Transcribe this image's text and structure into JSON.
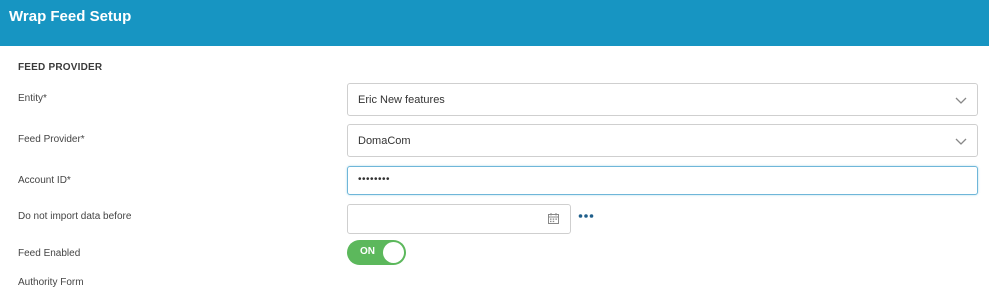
{
  "header": {
    "title": "Wrap Feed Setup",
    "bg_color": "#1795c2"
  },
  "section": {
    "title": "FEED PROVIDER"
  },
  "fields": {
    "entity": {
      "label": "Entity*",
      "value": "Eric New features",
      "icon": "chevron-down-icon"
    },
    "feed_provider": {
      "label": "Feed Provider*",
      "value": "DomaCom",
      "icon": "chevron-down-icon"
    },
    "account_id": {
      "label": "Account ID*",
      "value": "••••••••"
    },
    "import_before": {
      "label": "Do not import data before",
      "value": "",
      "icon": "calendar-icon",
      "extra_icon": "more-options-icon"
    },
    "feed_enabled": {
      "label": "Feed Enabled",
      "toggle_text": "ON",
      "toggle_color": "#5cb85c",
      "state": true
    },
    "authority_form": {
      "label": "Authority Form"
    }
  }
}
